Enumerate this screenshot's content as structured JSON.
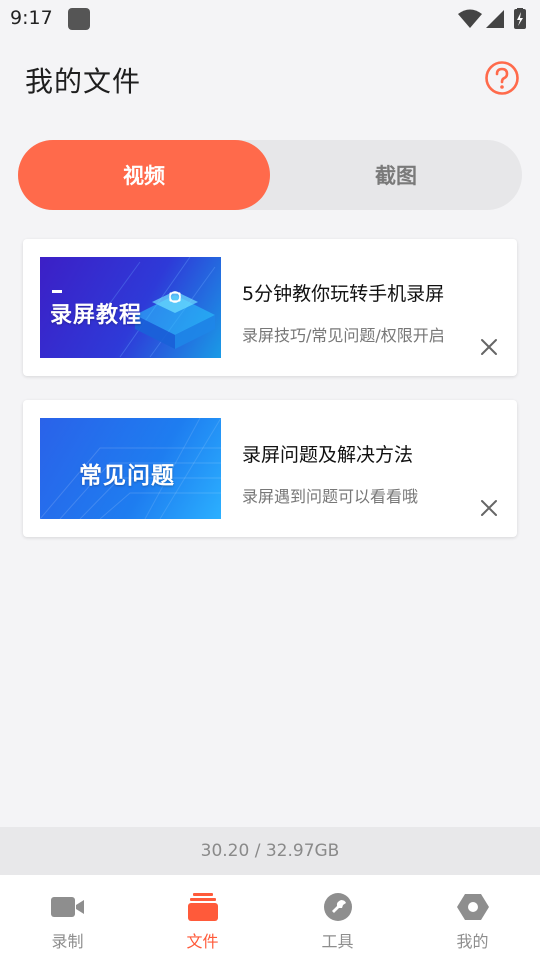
{
  "status_bar": {
    "time": "9:17"
  },
  "header": {
    "title": "我的文件",
    "help_icon": "question-circle-icon"
  },
  "segment": {
    "tabs": [
      "视频",
      "截图"
    ],
    "active": "视频"
  },
  "cards": [
    {
      "thumb_text": "录屏教程",
      "title": "5分钟教你玩转手机录屏",
      "subtitle": "录屏技巧/常见问题/权限开启"
    },
    {
      "thumb_text": "常见问题",
      "title": "录屏问题及解决方法",
      "subtitle": "录屏遇到问题可以看看哦"
    }
  ],
  "storage": {
    "text": "30.20 / 32.97GB"
  },
  "bottom_nav": {
    "items": [
      {
        "label": "录制",
        "icon": "video-camera-icon"
      },
      {
        "label": "文件",
        "icon": "folder-stack-icon"
      },
      {
        "label": "工具",
        "icon": "wrench-icon"
      },
      {
        "label": "我的",
        "icon": "profile-hexagon-icon"
      }
    ],
    "active": "文件"
  },
  "colors": {
    "accent": "#ff6a4b",
    "inactive": "#8e8e8e",
    "background": "#f4f4f6"
  }
}
